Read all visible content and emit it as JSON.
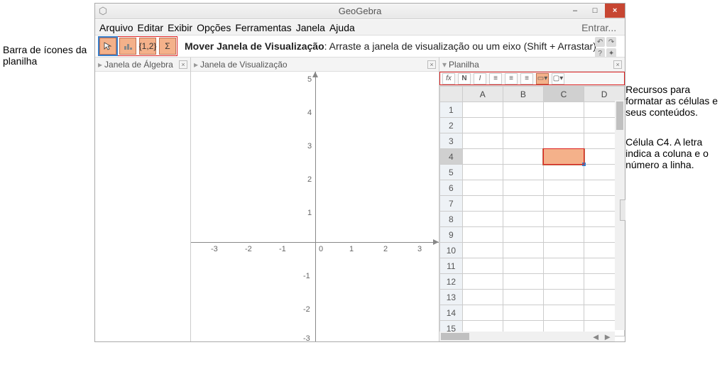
{
  "titlebar": {
    "title": "GeoGebra"
  },
  "menubar": {
    "items": [
      "Arquivo",
      "Editar",
      "Exibir",
      "Opções",
      "Ferramentas",
      "Janela",
      "Ajuda"
    ],
    "login": "Entrar..."
  },
  "toolbar": {
    "desc_bold": "Mover Janela de Visualização",
    "desc_rest": ": Arraste a janela de visualização ou um eixo (Shift + Arrastar)",
    "btn_list_label": "{1,2}",
    "btn_sigma_label": "Σ"
  },
  "panels": {
    "algebra": {
      "title": "Janela de Álgebra"
    },
    "graphics": {
      "title": "Janela de Visualização",
      "x_ticks": [
        "-3",
        "-2",
        "-1",
        "0",
        "1",
        "2",
        "3"
      ],
      "y_ticks": [
        "5",
        "4",
        "3",
        "2",
        "1",
        "-1",
        "-2",
        "-3"
      ]
    },
    "spreadsheet": {
      "title": "Planilha",
      "fx_label": "fx",
      "bold_label": "N",
      "italic_label": "I",
      "columns": [
        "A",
        "B",
        "C",
        "D"
      ],
      "rows": 15,
      "selected_col": "C",
      "selected_row": 4
    }
  },
  "callouts": {
    "left": "Barra de ícones da planilha",
    "right1": "Recursos para formatar as células e seus conteúdos.",
    "right2": "Célula C4. A letra indica a coluna e o número a linha."
  }
}
